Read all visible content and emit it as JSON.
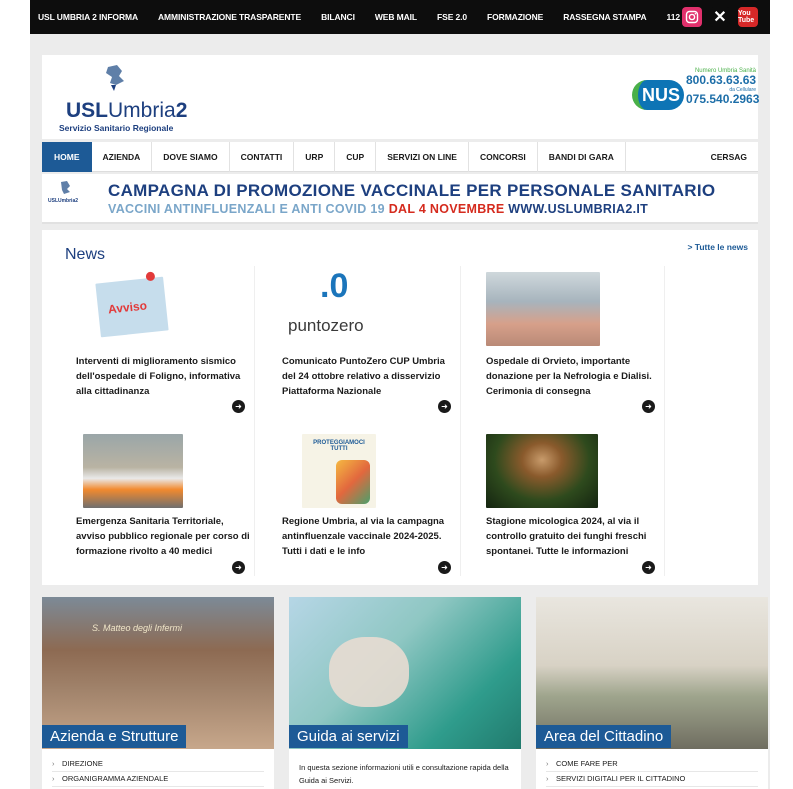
{
  "topbar": {
    "links": [
      "USL UMBRIA 2 INFORMA",
      "AMMINISTRAZIONE TRASPARENTE",
      "BILANCI",
      "WEB MAIL",
      "FSE 2.0",
      "FORMAZIONE",
      "RASSEGNA STAMPA",
      "112"
    ],
    "social": {
      "instagram": "instagram-icon",
      "x": "x-icon",
      "youtube": "youtube-icon"
    },
    "youtube_text": "You Tube"
  },
  "header": {
    "brand_bold": "USL",
    "brand_thin": "Umbria",
    "brand_num": "2",
    "brand_sub": "Servizio Sanitario Regionale",
    "nus_logo": "NUS",
    "nus_label": "Numero Umbria Sanità",
    "nus_phone1": "800.63.63.63",
    "nus_mobile": "da Cellulare",
    "nus_phone2": "075.540.2963"
  },
  "nav": [
    "HOME",
    "AZIENDA",
    "DOVE SIAMO",
    "CONTATTI",
    "URP",
    "CUP",
    "SERVIZI ON LINE",
    "CONCORSI",
    "BANDI DI GARA",
    "CERSAG"
  ],
  "banner": {
    "line1": "CAMPAGNA DI PROMOZIONE VACCINALE PER PERSONALE SANITARIO",
    "line2_a": "VACCINI ANTINFLUENZALI E ANTI COVID 19",
    "line2_b": "DAL 4 NOVEMBRE",
    "line2_c": "WWW.USLUMBRIA2.IT",
    "mini_logo": "USLUmbria2"
  },
  "news": {
    "title": "News",
    "all_link": "> Tutte le news",
    "items": [
      {
        "text": "Interventi di miglioramento sismico dell'ospedale di Foligno, informativa alla cittadinanza",
        "thumb_label": "Avviso"
      },
      {
        "text": "Comunicato PuntoZero CUP Umbria del 24 ottobre relativo a disservizio Piattaforma Nazionale",
        "thumb_label": "puntozero",
        "thumb_mark": ".0"
      },
      {
        "text": "Ospedale di Orvieto, importante donazione per la Nefrologia e Dialisi. Cerimonia di consegna",
        "thumb_label": ""
      },
      {
        "text": "Emergenza Sanitaria Territoriale, avviso pubblico regionale per corso di formazione rivolto a 40 medici",
        "thumb_label": ""
      },
      {
        "text": "Regione Umbria, al via la campagna antinfluenzale vaccinale 2024-2025. Tutti i dati e le info",
        "thumb_label": "PROTEGGIAMOCI TUTTI"
      },
      {
        "text": "Stagione micologica 2024, al via il controllo gratuito dei funghi freschi spontanei. Tutte le informazioni",
        "thumb_label": ""
      }
    ]
  },
  "tiles": [
    {
      "caption": "Azienda e Strutture",
      "sign": "S. Matteo degli Infermi",
      "items": [
        "DIREZIONE",
        "ORGANIGRAMMA AZIENDALE"
      ]
    },
    {
      "caption": "Guida ai servizi",
      "desc": "In questa sezione informazioni utili e consultazione rapida della Guida ai Servizi."
    },
    {
      "caption": "Area del Cittadino",
      "items": [
        "COME FARE PER",
        "SERVIZI DIGITALI PER IL CITTADINO"
      ]
    }
  ],
  "colors": {
    "primary": "#1d5a96",
    "brand": "#1d3f7f",
    "topbar": "#0d0d0d",
    "accent_red": "#d52b1e"
  }
}
